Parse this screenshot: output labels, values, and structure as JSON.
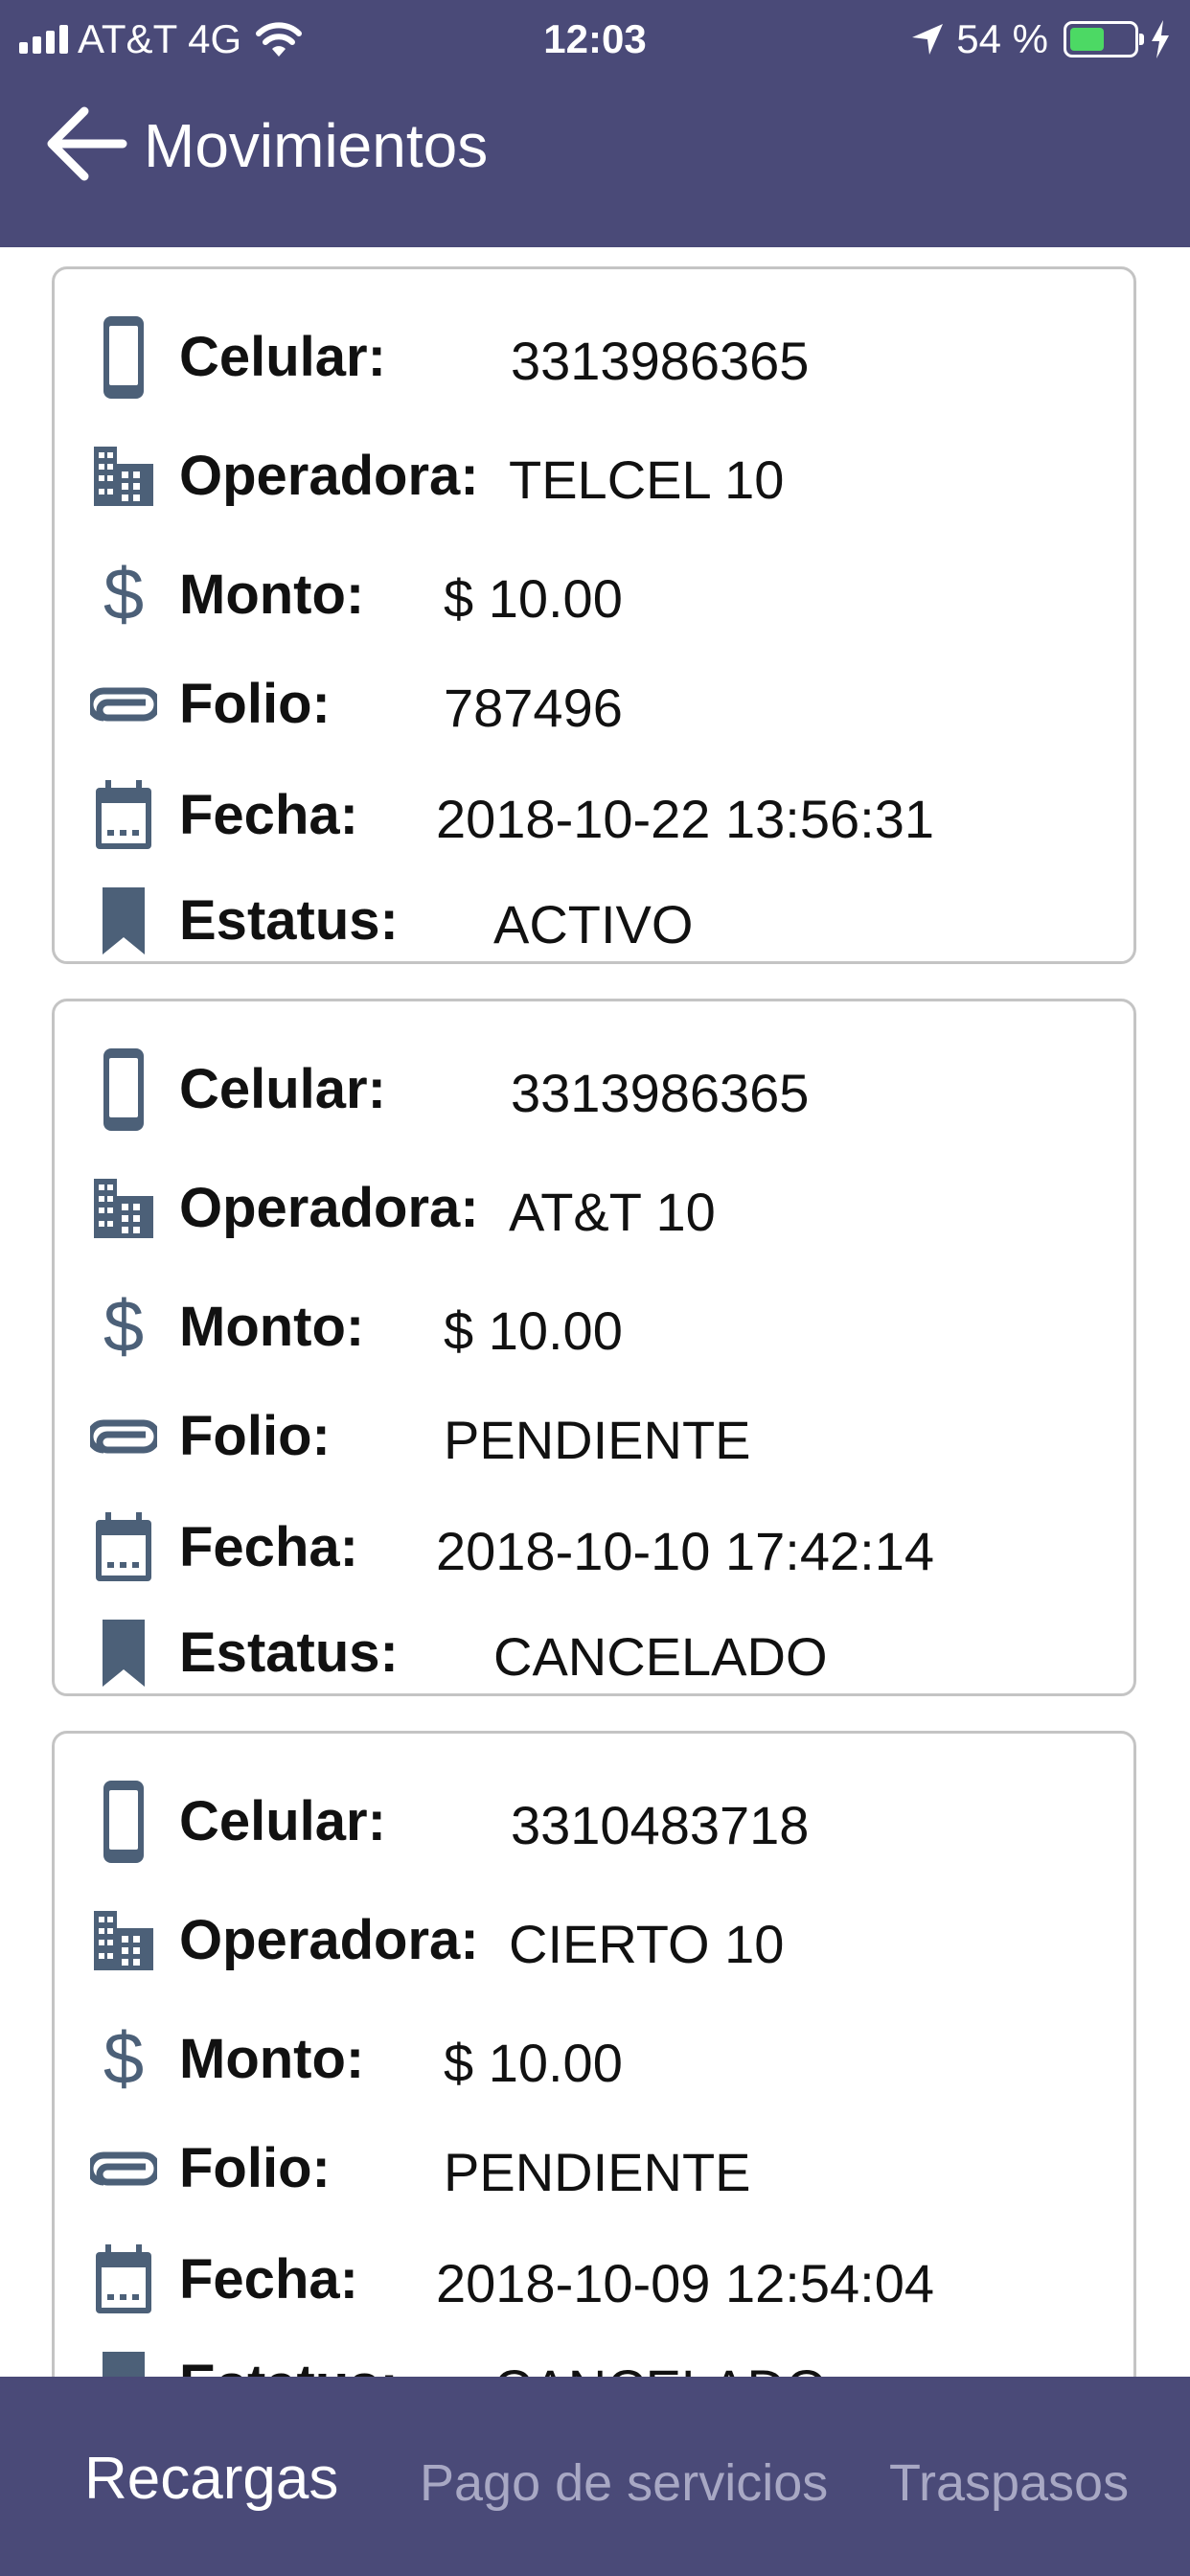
{
  "status_bar": {
    "carrier": "AT&T 4G",
    "time": "12:03",
    "battery_percent": "54 %",
    "battery_level": 0.54,
    "battery_color": "#4cd964"
  },
  "nav": {
    "title": "Movimientos",
    "back_icon": "arrow-left-icon"
  },
  "labels": {
    "celular": "Celular:",
    "operadora": "Operadora:",
    "monto": "Monto:",
    "folio": "Folio:",
    "fecha": "Fecha:",
    "estatus": "Estatus:"
  },
  "transactions": [
    {
      "celular": "3313986365",
      "operadora": "TELCEL 10",
      "monto": "$ 10.00",
      "folio": "787496",
      "fecha": "2018-10-22 13:56:31",
      "estatus": "ACTIVO"
    },
    {
      "celular": "3313986365",
      "operadora": "AT&T 10",
      "monto": "$ 10.00",
      "folio": "PENDIENTE",
      "fecha": "2018-10-10 17:42:14",
      "estatus": "CANCELADO"
    },
    {
      "celular": "3310483718",
      "operadora": "CIERTO 10",
      "monto": "$ 10.00",
      "folio": "PENDIENTE",
      "fecha": "2018-10-09 12:54:04",
      "estatus": "CANCELADO"
    }
  ],
  "tabs": [
    {
      "label": "Recargas",
      "active": true
    },
    {
      "label": "Pago de servicios",
      "active": false
    },
    {
      "label": "Traspasos",
      "active": false
    }
  ],
  "colors": {
    "header": "#4a4a78",
    "icon": "#4c6078",
    "tab_inactive": "#a8a8c4"
  }
}
